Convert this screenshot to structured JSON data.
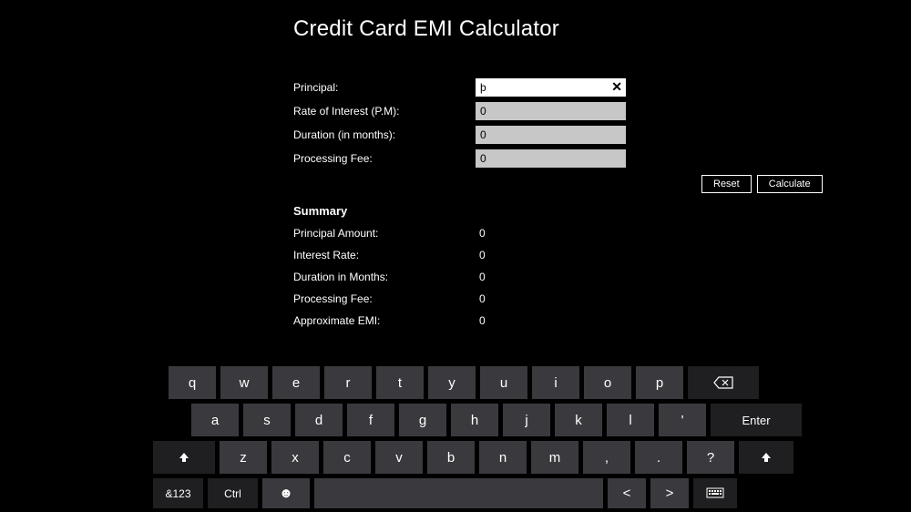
{
  "title": "Credit Card EMI Calculator",
  "form": {
    "principal_label": "Principal:",
    "principal_value": "þ",
    "rate_label": "Rate of Interest (P.M):",
    "rate_value": "0",
    "duration_label": "Duration (in months):",
    "duration_value": "0",
    "fee_label": "Processing Fee:",
    "fee_value": "0",
    "reset_label": "Reset",
    "calculate_label": "Calculate"
  },
  "summary": {
    "heading": "Summary",
    "principal_label": "Principal Amount:",
    "principal_value": "0",
    "rate_label": "Interest Rate:",
    "rate_value": "0",
    "duration_label": "Duration in Months:",
    "duration_value": "0",
    "fee_label": "Processing Fee:",
    "fee_value": "0",
    "emi_label": "Approximate EMI:",
    "emi_value": "0"
  },
  "keyboard": {
    "row1": [
      "q",
      "w",
      "e",
      "r",
      "t",
      "y",
      "u",
      "i",
      "o",
      "p"
    ],
    "row2": [
      "a",
      "s",
      "d",
      "f",
      "g",
      "h",
      "j",
      "k",
      "l",
      "'"
    ],
    "enter": "Enter",
    "row3": [
      "z",
      "x",
      "c",
      "v",
      "b",
      "n",
      "m",
      ",",
      ".",
      "?"
    ],
    "sym": "&123",
    "ctrl": "Ctrl"
  }
}
